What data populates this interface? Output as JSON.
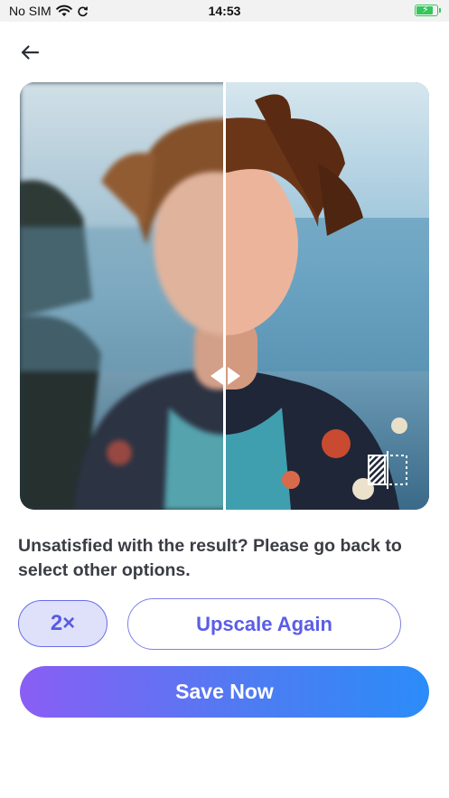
{
  "status_bar": {
    "carrier": "No SIM",
    "time": "14:53",
    "battery_level": 0.85,
    "battery_color": "#34c759",
    "icons": [
      "wifi-icon",
      "sync-icon",
      "battery-icon"
    ]
  },
  "header": {
    "back_icon": "arrow-left-icon"
  },
  "preview": {
    "divider_position": 0.5,
    "handle_icon": "drag-handle-icon",
    "compare_icon": "compare-toggle-icon"
  },
  "message": "Unsatisfied with the result? Please go back to select other options.",
  "actions": {
    "scale_label": "2×",
    "upscale_label": "Upscale Again",
    "save_label": "Save Now"
  },
  "colors": {
    "accent": "#5b5de6",
    "chip_bg": "#dfe1fb",
    "save_gradient_start": "#8a5ef4",
    "save_gradient_end": "#2b8cf8"
  }
}
